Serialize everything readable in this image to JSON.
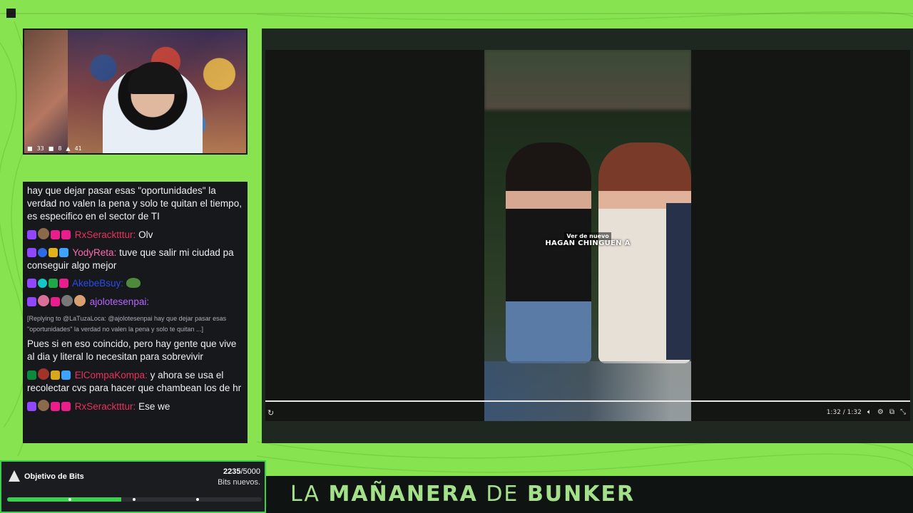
{
  "webcam": {
    "stats": [
      "33",
      "8",
      "41"
    ]
  },
  "chat": {
    "messages": [
      {
        "text": "hay que dejar pasar esas \"oportunidades\" la verdad no valen la pena y solo te quitan el tiempo, es especifico en el sector de TI"
      },
      {
        "user": "RxSeracktttur:",
        "user_color": "#e8325a",
        "text": "Olv"
      },
      {
        "user": "YodyReta:",
        "user_color": "#ff69b4",
        "text": "tuve que salir mi ciudad pa conseguir algo mejor"
      },
      {
        "user": "AkebeBsuy:",
        "user_color": "#2a4be6",
        "text": ""
      },
      {
        "user": "ajolotesenpai:",
        "user_color": "#b864ff",
        "text": ""
      },
      {
        "reply": "[Replying to @LaTuzaLoca: @ajolotesenpai hay que dejar pasar esas \"oportunidades\" la verdad no valen la pena y solo te quitan ...]"
      },
      {
        "text": "Pues si en eso coincido, pero hay gente que vive al dia y literal lo necesitan para sobrevivir"
      },
      {
        "user": "ElCompaKompa:",
        "user_color": "#e8325a",
        "text": "y ahora se usa el recolectar cvs para hacer que chambean los de hr"
      },
      {
        "user": "RxSeracktttur:",
        "user_color": "#e8325a",
        "text": "Ese we"
      }
    ]
  },
  "player": {
    "replay_label": "Ver de nuevo",
    "caption": "HAGAN CHINGUEN A",
    "time": "1:32 / 1:32",
    "progress": 1.0
  },
  "bits": {
    "title": "Objetivo de Bits",
    "current": "2235",
    "total": "/5000",
    "subtitle": "Bits nuevos.",
    "progress": 0.447
  },
  "banner": {
    "part1": "LA ",
    "part2": "MAÑANERA",
    "part3": " DE ",
    "part4": "BUNKER"
  },
  "colors": {
    "background": "#87e34f",
    "accent": "#3ccf4e"
  }
}
